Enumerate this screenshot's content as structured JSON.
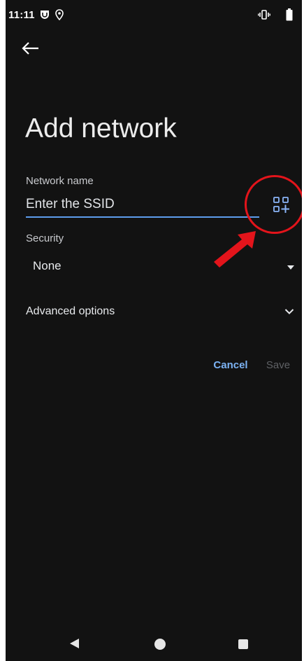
{
  "status_bar": {
    "time": "11:11",
    "icons": [
      "shield-icon",
      "location-icon",
      "vibrate-icon",
      "battery-icon"
    ]
  },
  "header": {
    "back_icon": "arrow-back-icon",
    "title": "Add network"
  },
  "form": {
    "network_name": {
      "label": "Network name",
      "placeholder": "Enter the SSID",
      "value": "",
      "qr_scan_icon": "qr-code-add-icon"
    },
    "security": {
      "label": "Security",
      "selected": "None",
      "icon": "dropdown-triangle-icon"
    },
    "advanced": {
      "label": "Advanced options",
      "icon": "chevron-down-icon"
    }
  },
  "actions": {
    "cancel_label": "Cancel",
    "save_label": "Save"
  },
  "annotation": {
    "highlight_color": "#e3141b",
    "target": "qr-code-add-icon"
  },
  "nav_bar": {
    "icons": [
      "nav-back-icon",
      "nav-home-icon",
      "nav-recents-icon"
    ]
  },
  "colors": {
    "background": "#121212",
    "accent": "#7cb3f4",
    "input_underline": "#5d9cec",
    "text_primary": "#e8eaed",
    "text_disabled": "#5f6165"
  }
}
